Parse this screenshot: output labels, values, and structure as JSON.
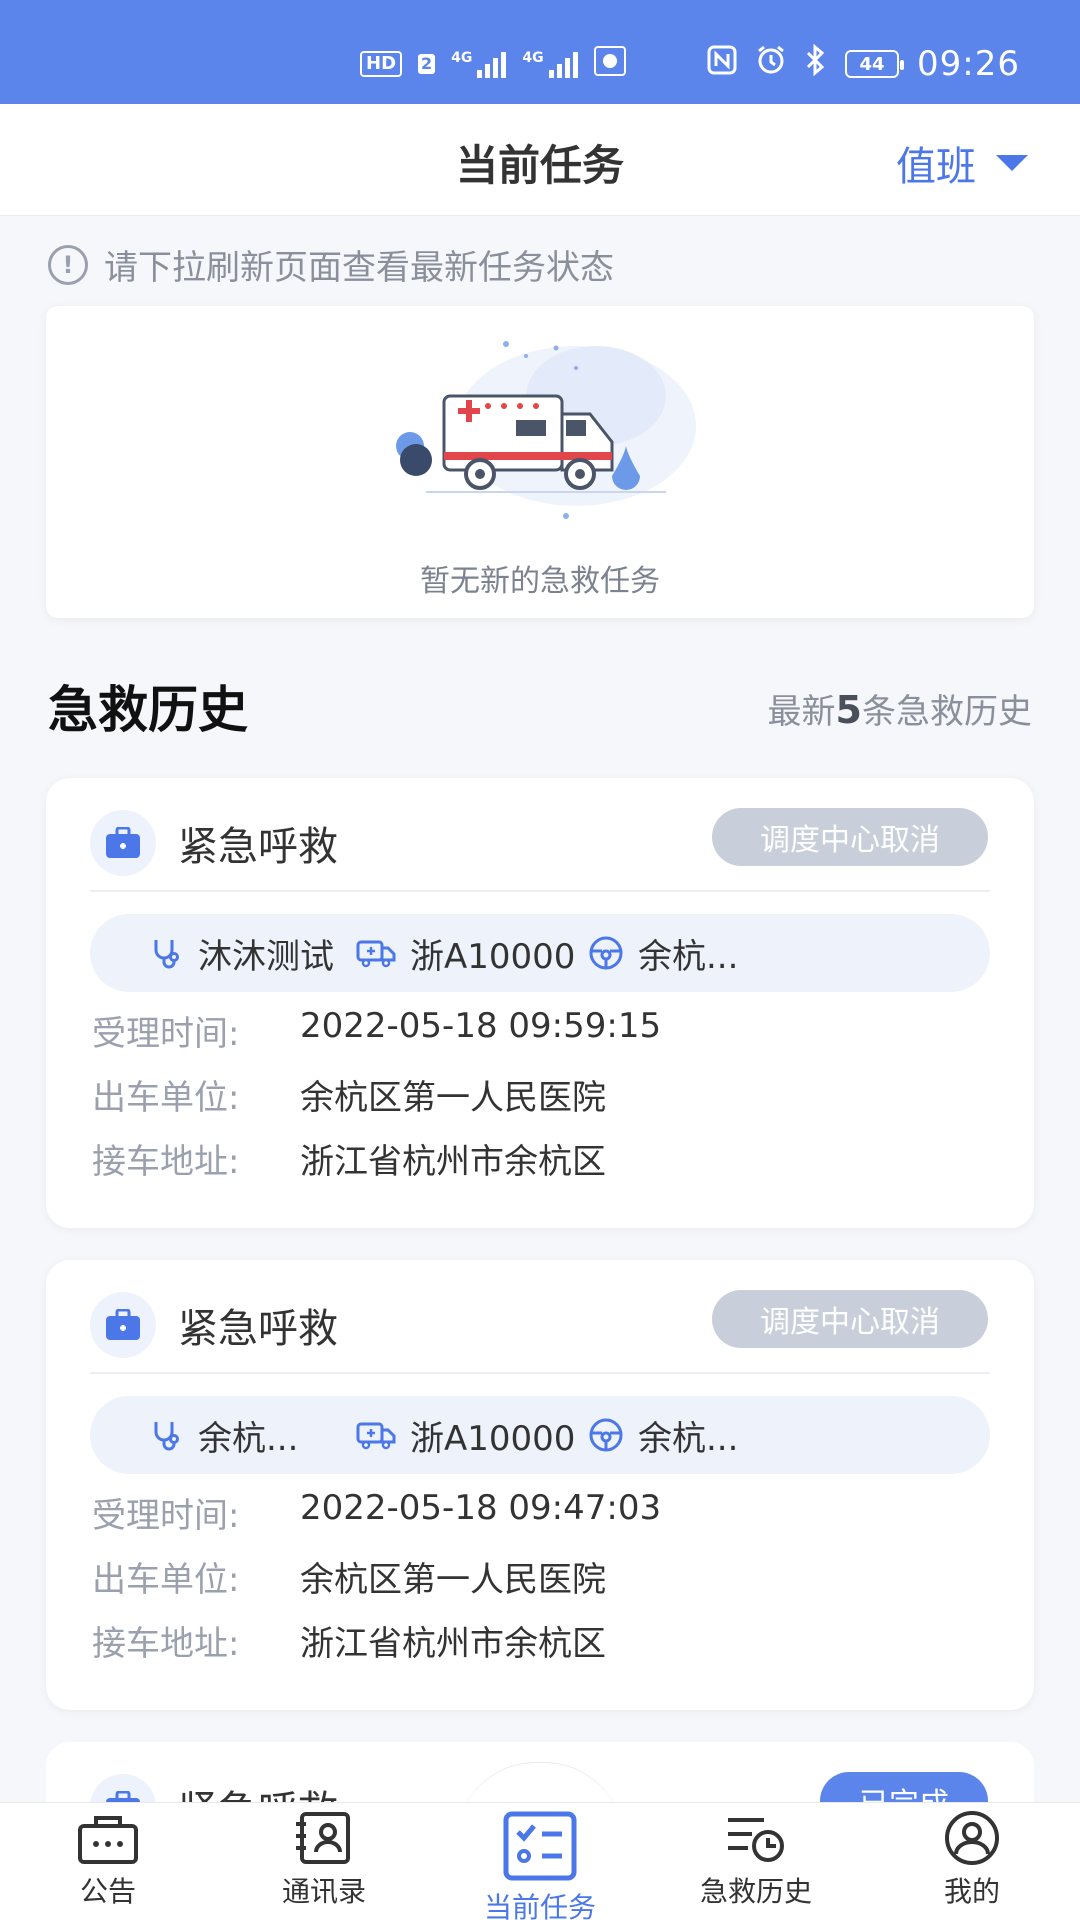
{
  "status_bar": {
    "hd": "HD",
    "sim": "2",
    "net1": "4G",
    "net2": "4G",
    "battery": "44",
    "time": "09:26"
  },
  "header": {
    "title": "当前任务",
    "duty_label": "值班"
  },
  "notice": {
    "text": "请下拉刷新页面查看最新任务状态"
  },
  "empty_card": {
    "text": "暂无新的急救任务"
  },
  "history": {
    "title": "急救历史",
    "subtitle_prefix": "最新",
    "subtitle_count": "5",
    "subtitle_suffix": "条急救历史",
    "records": [
      {
        "type": "紧急呼救",
        "status": "调度中心取消",
        "doctor": "沐沐测试",
        "vehicle": "浙A10000",
        "driver": "余杭...",
        "accept_time_label": "受理时间:",
        "accept_time": "2022-05-18 09:59:15",
        "unit_label": "出车单位:",
        "unit": "余杭区第一人民医院",
        "address_label": "接车地址:",
        "address": "浙江省杭州市余杭区"
      },
      {
        "type": "紧急呼救",
        "status": "调度中心取消",
        "doctor": "余杭...",
        "vehicle": "浙A10000",
        "driver": "余杭...",
        "accept_time_label": "受理时间:",
        "accept_time": "2022-05-18 09:47:03",
        "unit_label": "出车单位:",
        "unit": "余杭区第一人民医院",
        "address_label": "接车地址:",
        "address": "浙江省杭州市余杭区"
      },
      {
        "type": "紧急呼救",
        "status": "已完成"
      }
    ]
  },
  "bottom_nav": {
    "items": [
      {
        "label": "公告",
        "icon": "announcement-icon"
      },
      {
        "label": "通讯录",
        "icon": "contacts-icon"
      },
      {
        "label": "当前任务",
        "icon": "task-list-icon"
      },
      {
        "label": "急救历史",
        "icon": "history-icon"
      },
      {
        "label": "我的",
        "icon": "profile-icon"
      }
    ],
    "active_index": 2
  },
  "colors": {
    "accent": "#5b85ea",
    "badge_cancel": "#c9cfda",
    "background": "#f6f7fb"
  }
}
